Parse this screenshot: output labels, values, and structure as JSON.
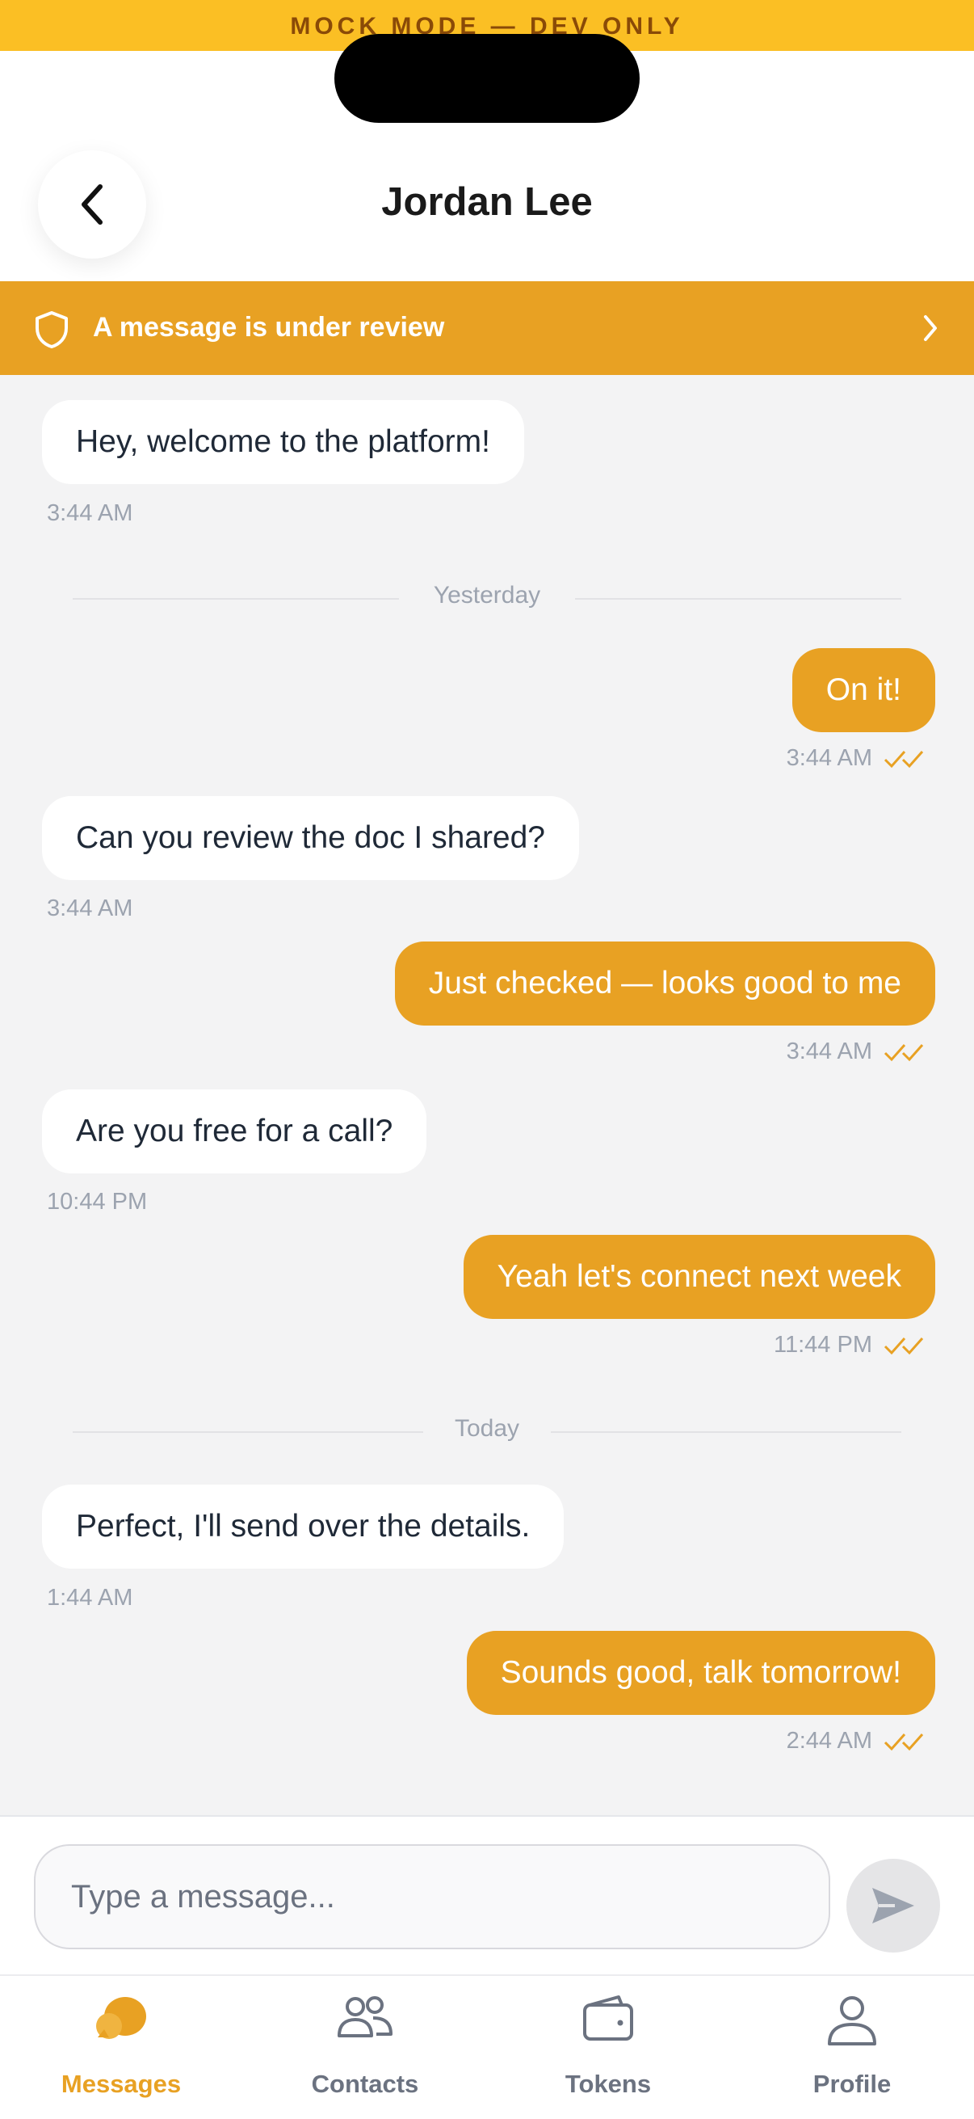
{
  "mock_banner": "MOCK MODE — DEV ONLY",
  "header": {
    "title": "Jordan Lee"
  },
  "review_banner": {
    "text": "A message is under review"
  },
  "dividers": {
    "yesterday": "Yesterday",
    "today": "Today"
  },
  "messages": [
    {
      "direction": "in",
      "text": "Hey, welcome to the platform!",
      "time": "3:44 AM"
    },
    {
      "direction": "out",
      "text": "On it!",
      "time": "3:44 AM",
      "status": "read"
    },
    {
      "direction": "in",
      "text": "Can you review the doc I shared?",
      "time": "3:44 AM"
    },
    {
      "direction": "out",
      "text": "Just checked — looks good to me",
      "time": "3:44 AM",
      "status": "read"
    },
    {
      "direction": "in",
      "text": "Are you free for a call?",
      "time": "10:44 PM"
    },
    {
      "direction": "out",
      "text": "Yeah let's connect next week",
      "time": "11:44 PM",
      "status": "read"
    },
    {
      "direction": "in",
      "text": "Perfect, I'll send over the details.",
      "time": "1:44 AM"
    },
    {
      "direction": "out",
      "text": "Sounds good, talk tomorrow!",
      "time": "2:44 AM",
      "status": "read"
    }
  ],
  "composer": {
    "placeholder": "Type a message..."
  },
  "tabs": [
    {
      "label": "Messages",
      "icon": "chat-bubble-icon",
      "active": true
    },
    {
      "label": "Contacts",
      "icon": "contacts-icon",
      "active": false
    },
    {
      "label": "Tokens",
      "icon": "wallet-icon",
      "active": false
    },
    {
      "label": "Profile",
      "icon": "profile-icon",
      "active": false
    }
  ],
  "colors": {
    "accent": "#e8a123",
    "mock_banner": "#fbbf24",
    "background": "#f3f3f4"
  }
}
